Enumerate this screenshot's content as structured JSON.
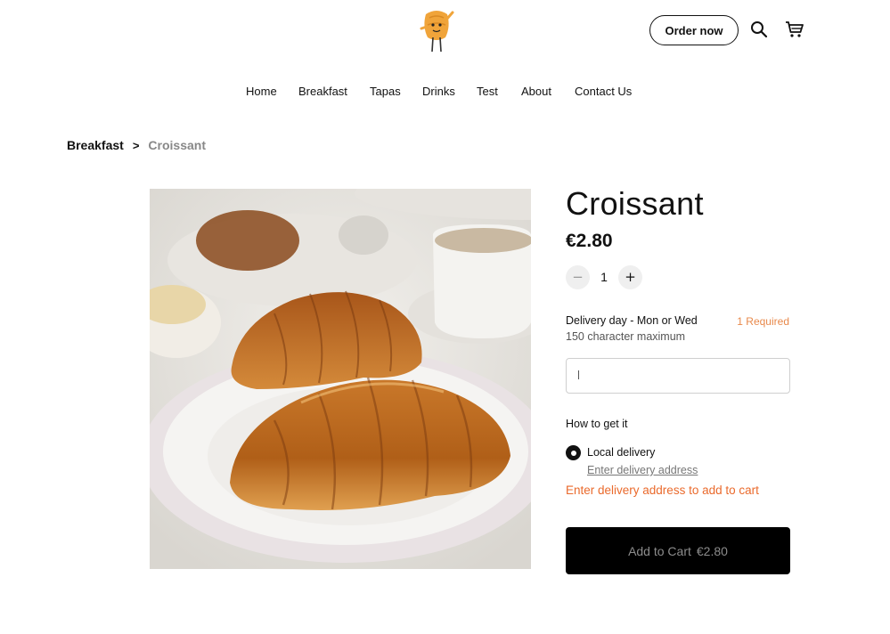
{
  "header": {
    "logo_icon": "croissant-mascot-icon",
    "order_button": "Order now",
    "search_icon": "search-icon",
    "cart_icon": "cart-icon"
  },
  "nav": {
    "items": [
      "Home",
      "Breakfast",
      "Tapas",
      "Drinks",
      "Test",
      "About",
      "Contact Us"
    ]
  },
  "breadcrumb": {
    "parent": "Breakfast",
    "separator": ">",
    "current": "Croissant"
  },
  "product": {
    "name": "Croissant",
    "price": "€2.80",
    "quantity": "1",
    "minus_icon": "minus-icon",
    "plus_icon": "plus-icon"
  },
  "custom_field": {
    "label": "Delivery day - Mon or Wed",
    "required": "1 Required",
    "hint": "150 character maximum",
    "value": ""
  },
  "fulfillment": {
    "label": "How to get it",
    "option": "Local delivery",
    "option_selected": true,
    "address_link": "Enter delivery address",
    "error": "Enter delivery address to add to cart"
  },
  "add_to_cart": {
    "label": "Add to Cart",
    "price": "€2.80"
  },
  "colors": {
    "accent_orange": "#e8894b",
    "error_orange": "#ea6a2c",
    "button_black": "#000000"
  }
}
